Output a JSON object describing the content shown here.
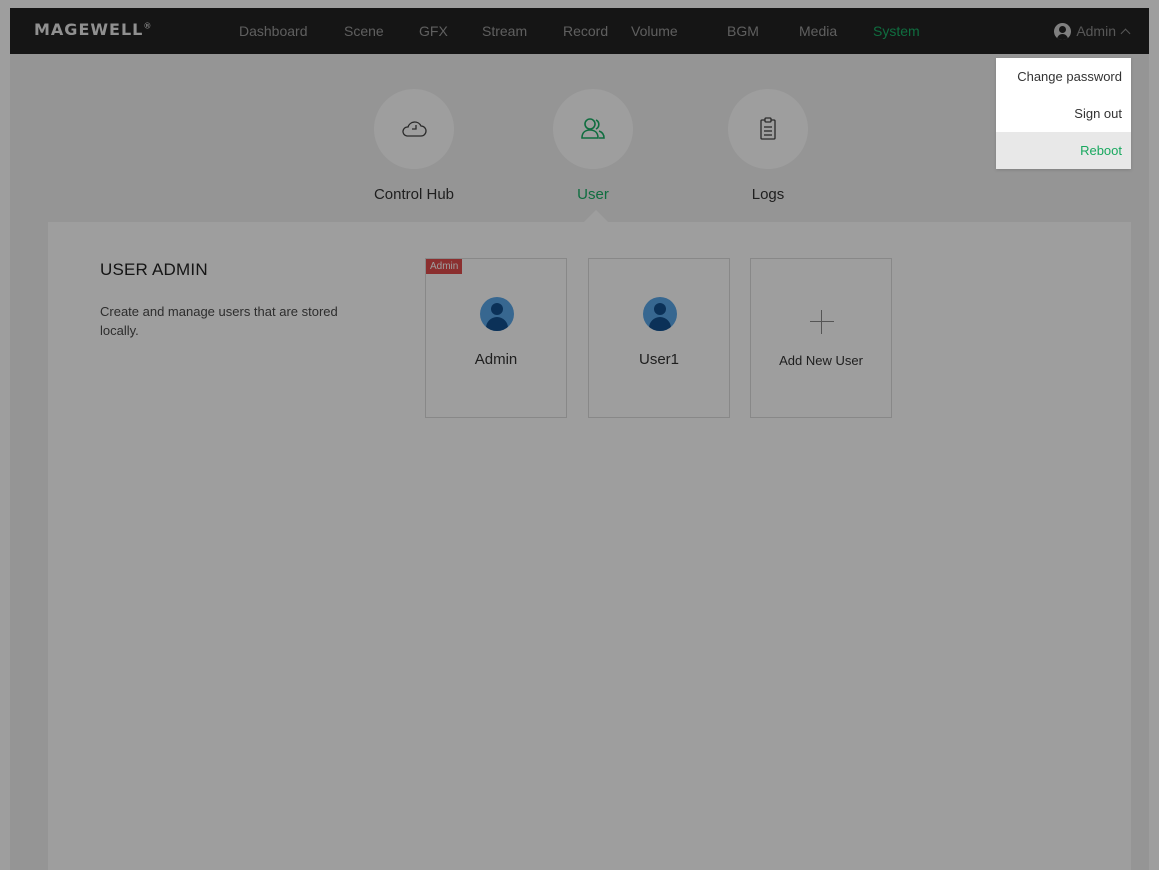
{
  "brand": {
    "logo_text": "MAGEWELL",
    "logo_mark": "®"
  },
  "nav": {
    "items": [
      {
        "label": "Dashboard"
      },
      {
        "label": "Scene"
      },
      {
        "label": "GFX"
      },
      {
        "label": "Stream"
      },
      {
        "label": "Record"
      },
      {
        "label": "Volume"
      },
      {
        "label": "BGM"
      },
      {
        "label": "Media"
      },
      {
        "label": "System"
      }
    ],
    "active": "System",
    "user_label": "Admin"
  },
  "system_tabs": [
    {
      "label": "Control Hub",
      "icon": "cloud-icon"
    },
    {
      "label": "User",
      "icon": "users-icon"
    },
    {
      "label": "Logs",
      "icon": "clipboard-icon"
    }
  ],
  "active_tab": "User",
  "user_admin": {
    "title": "USER ADMIN",
    "description": "Create and manage users that are stored locally.",
    "users": [
      {
        "name": "Admin",
        "badge": "Admin"
      },
      {
        "name": "User1",
        "badge": ""
      }
    ],
    "add_label": "Add New User"
  },
  "user_dropdown": {
    "items": [
      {
        "label": "Change password"
      },
      {
        "label": "Sign out"
      },
      {
        "label": "Reboot"
      }
    ],
    "highlighted": "Reboot"
  },
  "colors": {
    "accent": "#19b067",
    "topbar": "#232323",
    "badge": "#e14c4c",
    "avatar": "#5aa7e8"
  }
}
